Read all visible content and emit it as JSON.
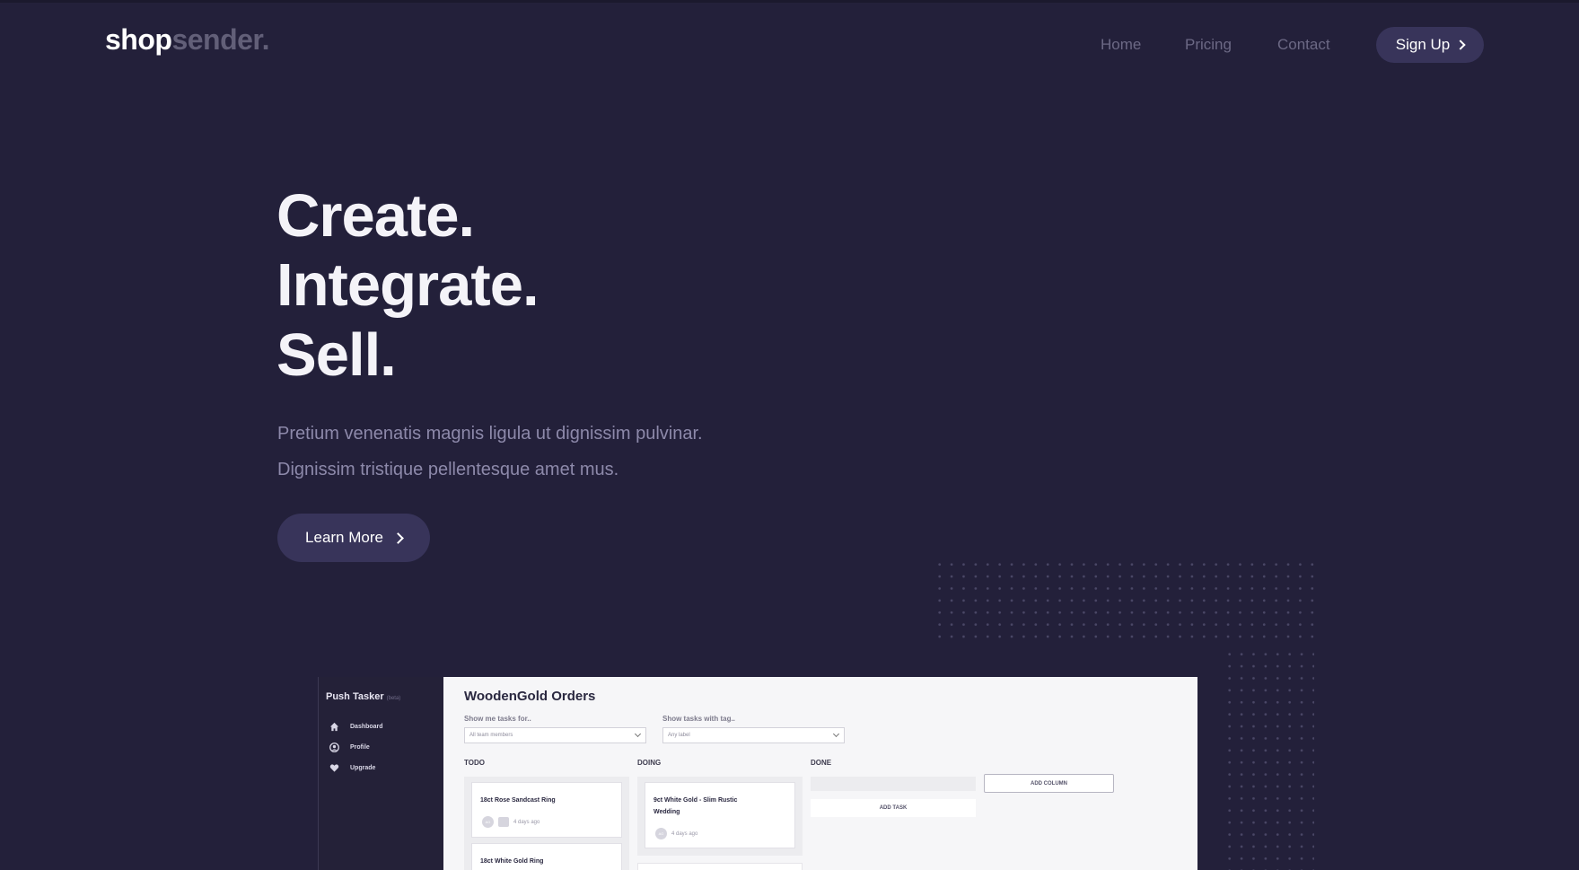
{
  "logo": {
    "part1": "shop",
    "part2": "sender."
  },
  "nav": {
    "links": [
      "Home",
      "Pricing",
      "Contact"
    ],
    "signup_label": "Sign Up"
  },
  "hero": {
    "lines": [
      "Create.",
      "Integrate.",
      "Sell."
    ],
    "subtitle_lines": [
      "Pretium venenatis magnis ligula ut dignissim pulvinar.",
      "Dignissim tristique pellentesque amet mus."
    ],
    "cta_label": "Learn More"
  },
  "mockup": {
    "sidebar": {
      "title": "Push Tasker",
      "badge": "(beta)",
      "items": [
        {
          "label": "Dashboard",
          "icon": "home-icon"
        },
        {
          "label": "Profile",
          "icon": "user-icon"
        },
        {
          "label": "Upgrade",
          "icon": "heart-icon"
        }
      ]
    },
    "title": "WoodenGold Orders",
    "filters": [
      {
        "label": "Show me tasks for..",
        "value": "All team members"
      },
      {
        "label": "Show tasks with tag..",
        "value": "Any label"
      }
    ],
    "columns": {
      "todo": {
        "title": "TODO",
        "cards": [
          {
            "title": "18ct Rose Sandcast Ring",
            "avatar": "AG",
            "time": "4 days ago"
          },
          {
            "title": "18ct White Gold Ring"
          }
        ]
      },
      "doing": {
        "title": "DOING",
        "cards": [
          {
            "title_line1": "9ct White Gold - Slim Rustic",
            "title_line2": "Wedding",
            "avatar": "AG",
            "time": "4 days ago"
          }
        ]
      },
      "done": {
        "title": "DONE"
      }
    },
    "add_column_label": "ADD COLUMN",
    "add_task_label": "ADD TASK"
  },
  "colors": {
    "background": "#23203a",
    "button": "#38345a",
    "logo_muted": "#625f78"
  }
}
